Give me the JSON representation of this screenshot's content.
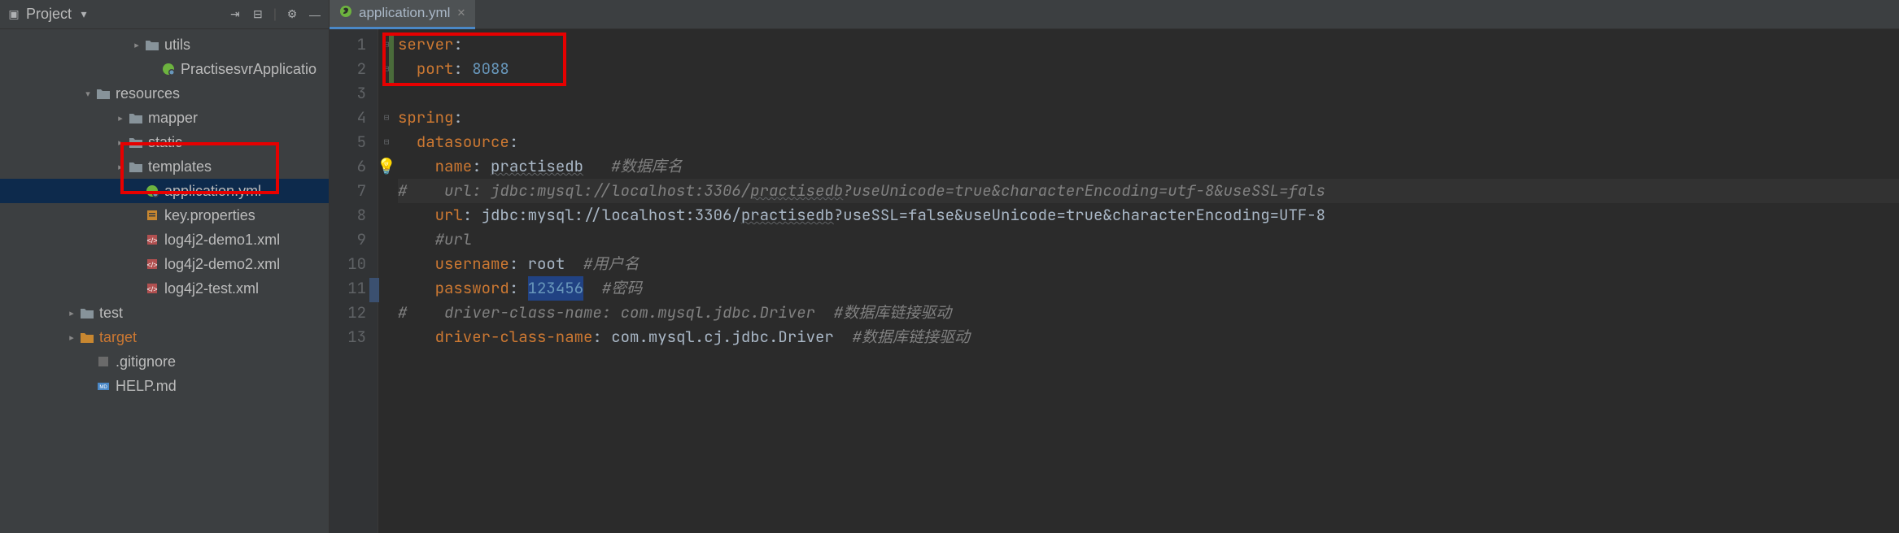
{
  "sidebar": {
    "title": "Project",
    "items": [
      {
        "indent": 160,
        "arrow": ">",
        "icon": "folder",
        "label": "utils"
      },
      {
        "indent": 180,
        "arrow": "",
        "icon": "spring",
        "label": "PractisesvrApplicatio"
      },
      {
        "indent": 100,
        "arrow": "v",
        "icon": "folder",
        "label": "resources"
      },
      {
        "indent": 140,
        "arrow": ">",
        "icon": "folder",
        "label": "mapper"
      },
      {
        "indent": 140,
        "arrow": ">",
        "icon": "folder",
        "label": "static"
      },
      {
        "indent": 140,
        "arrow": ">",
        "icon": "folder",
        "label": "templates"
      },
      {
        "indent": 160,
        "arrow": "",
        "icon": "spring",
        "label": "application.yml",
        "selected": true
      },
      {
        "indent": 160,
        "arrow": "",
        "icon": "props",
        "label": "key.properties"
      },
      {
        "indent": 160,
        "arrow": "",
        "icon": "xml",
        "label": "log4j2-demo1.xml"
      },
      {
        "indent": 160,
        "arrow": "",
        "icon": "xml",
        "label": "log4j2-demo2.xml"
      },
      {
        "indent": 160,
        "arrow": "",
        "icon": "xml",
        "label": "log4j2-test.xml"
      },
      {
        "indent": 80,
        "arrow": ">",
        "icon": "folder",
        "label": "test"
      },
      {
        "indent": 80,
        "arrow": ">",
        "icon": "folder-orange",
        "label": "target",
        "labelClass": "orange"
      },
      {
        "indent": 100,
        "arrow": "",
        "icon": "gitignore",
        "label": ".gitignore"
      },
      {
        "indent": 100,
        "arrow": "",
        "icon": "md",
        "label": "HELP.md"
      }
    ]
  },
  "tab": {
    "label": "application.yml"
  },
  "code": {
    "lines": [
      {
        "n": 1,
        "fold": "-",
        "segs": [
          {
            "t": "server",
            "c": "k"
          },
          {
            "t": ":",
            "c": "s"
          }
        ]
      },
      {
        "n": 2,
        "fold": "-",
        "segs": [
          {
            "t": "  ",
            "c": "s"
          },
          {
            "t": "port",
            "c": "k"
          },
          {
            "t": ": ",
            "c": "s"
          },
          {
            "t": "8088",
            "c": "v"
          }
        ]
      },
      {
        "n": 3,
        "segs": []
      },
      {
        "n": 4,
        "fold": "-",
        "segs": [
          {
            "t": "spring",
            "c": "k"
          },
          {
            "t": ":",
            "c": "s"
          }
        ]
      },
      {
        "n": 5,
        "fold": "-",
        "segs": [
          {
            "t": "  ",
            "c": "s"
          },
          {
            "t": "datasource",
            "c": "k"
          },
          {
            "t": ":",
            "c": "s"
          }
        ]
      },
      {
        "n": 6,
        "bulb": true,
        "segs": [
          {
            "t": "    ",
            "c": "s"
          },
          {
            "t": "name",
            "c": "k"
          },
          {
            "t": ": ",
            "c": "s"
          },
          {
            "t": "practisedb",
            "c": "s underline"
          },
          {
            "t": "   ",
            "c": "s"
          },
          {
            "t": "#数据库名",
            "c": "c"
          }
        ]
      },
      {
        "n": 7,
        "hl": true,
        "segs": [
          {
            "t": "#    url: jdbc:mysql:",
            "c": "c"
          },
          {
            "t": "//localhost:3306/",
            "c": "c"
          },
          {
            "t": "practisedb",
            "c": "c underline"
          },
          {
            "t": "?useUnicode=true&characterEncoding=utf-8&useSSL=fals",
            "c": "c"
          }
        ]
      },
      {
        "n": 8,
        "segs": [
          {
            "t": "    ",
            "c": "s"
          },
          {
            "t": "url",
            "c": "k"
          },
          {
            "t": ": ",
            "c": "s"
          },
          {
            "t": "jdbc:mysql://localhost:3306/",
            "c": "s"
          },
          {
            "t": "practisedb",
            "c": "s underline"
          },
          {
            "t": "?useSSL=false&useUnicode=true&characterEncoding=UTF-8",
            "c": "s"
          }
        ]
      },
      {
        "n": 9,
        "segs": [
          {
            "t": "    ",
            "c": "s"
          },
          {
            "t": "#url",
            "c": "c"
          }
        ]
      },
      {
        "n": 10,
        "segs": [
          {
            "t": "    ",
            "c": "s"
          },
          {
            "t": "username",
            "c": "k"
          },
          {
            "t": ": ",
            "c": "s"
          },
          {
            "t": "root",
            "c": "s"
          },
          {
            "t": "  ",
            "c": "s"
          },
          {
            "t": "#用户名",
            "c": "c"
          }
        ]
      },
      {
        "n": 11,
        "segs": [
          {
            "t": "    ",
            "c": "s"
          },
          {
            "t": "password",
            "c": "k"
          },
          {
            "t": ": ",
            "c": "s"
          },
          {
            "t": "123456",
            "c": "v sel"
          },
          {
            "t": "  ",
            "c": "s"
          },
          {
            "t": "#密码",
            "c": "c"
          }
        ]
      },
      {
        "n": 12,
        "segs": [
          {
            "t": "#    driver-class-name: com.mysql.jdbc.Driver  #数据库链接驱动",
            "c": "c"
          }
        ]
      },
      {
        "n": 13,
        "segs": [
          {
            "t": "    ",
            "c": "s"
          },
          {
            "t": "driver-class-name",
            "c": "k"
          },
          {
            "t": ": ",
            "c": "s"
          },
          {
            "t": "com.mysql.cj.jdbc.Driver",
            "c": "s"
          },
          {
            "t": "  ",
            "c": "s"
          },
          {
            "t": "#数据库链接驱动",
            "c": "c"
          }
        ]
      }
    ]
  }
}
